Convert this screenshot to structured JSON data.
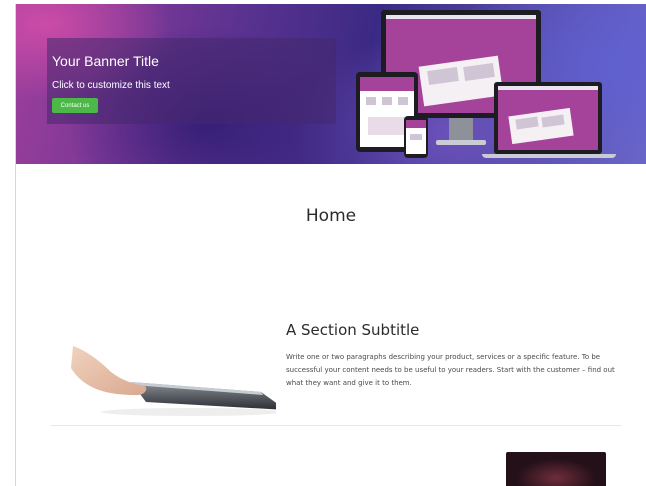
{
  "banner": {
    "title": "Your Banner Title",
    "text": "Click to customize this text",
    "button_label": "Contact us"
  },
  "page": {
    "title": "Home"
  },
  "section": {
    "subtitle": "A Section Subtitle",
    "body": "Write one or two paragraphs describing your product, services or a specific feature. To be successful your content needs to be useful to your readers. Start with the customer – find out what they want and give it to them."
  },
  "colors": {
    "accent_button": "#4cb848",
    "device_screen": "#a5429a"
  }
}
